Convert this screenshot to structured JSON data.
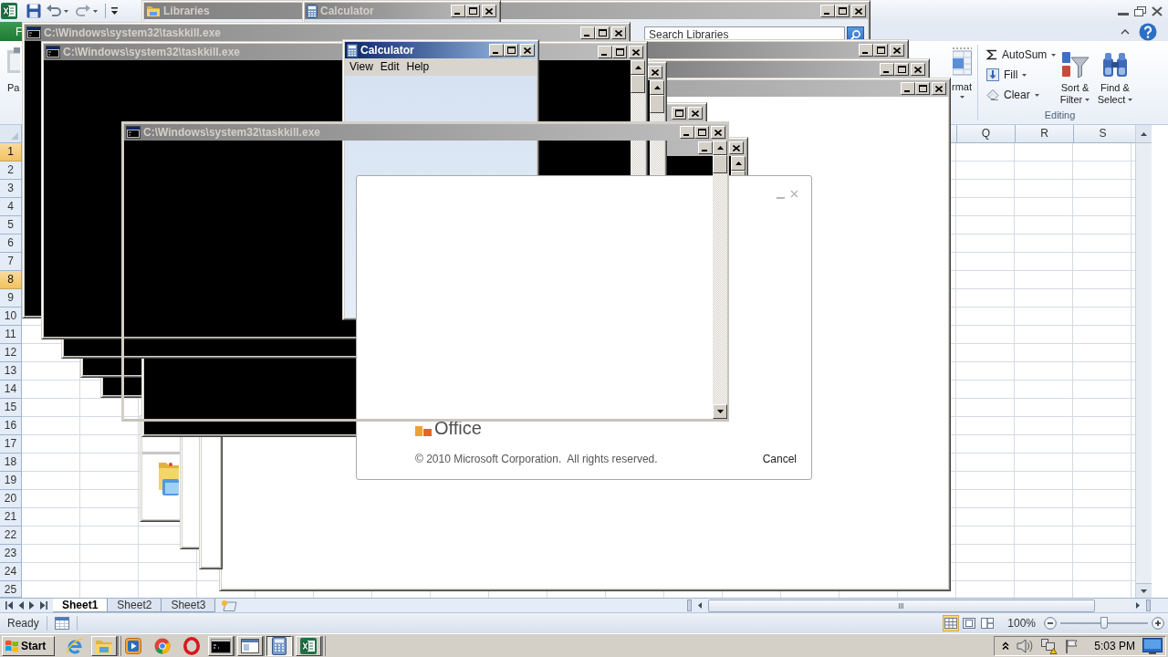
{
  "excel": {
    "file_tab": "F",
    "ribbon": {
      "paste_label": "Pa",
      "format_label": "rmat",
      "editing_items": [
        {
          "kind": "sum",
          "label": "AutoSum"
        },
        {
          "kind": "fill",
          "label": "Fill"
        },
        {
          "kind": "clear",
          "label": "Clear"
        }
      ],
      "editing_buttons": [
        {
          "kind": "sort",
          "label": "Sort & Filter"
        },
        {
          "kind": "find",
          "label": "Find & Select"
        }
      ],
      "group_label": "Editing"
    },
    "columns": [
      "Q",
      "R",
      "S"
    ],
    "rows": [
      {
        "label": "1",
        "selected": true
      },
      {
        "label": "2",
        "selected": false
      },
      {
        "label": "3",
        "selected": false
      },
      {
        "label": "4",
        "selected": false
      },
      {
        "label": "5",
        "selected": false
      },
      {
        "label": "6",
        "selected": false
      },
      {
        "label": "7",
        "selected": false
      },
      {
        "label": "8",
        "selected": true
      },
      {
        "label": "9",
        "selected": false
      },
      {
        "label": "10",
        "selected": false
      },
      {
        "label": "11",
        "selected": false
      },
      {
        "label": "12",
        "selected": false
      },
      {
        "label": "13",
        "selected": false
      },
      {
        "label": "14",
        "selected": false
      },
      {
        "label": "15",
        "selected": false
      },
      {
        "label": "16",
        "selected": false
      },
      {
        "label": "17",
        "selected": false
      },
      {
        "label": "18",
        "selected": false
      },
      {
        "label": "19",
        "selected": false
      },
      {
        "label": "20",
        "selected": false
      },
      {
        "label": "21",
        "selected": false
      },
      {
        "label": "22",
        "selected": false
      },
      {
        "label": "23",
        "selected": false
      },
      {
        "label": "24",
        "selected": false
      },
      {
        "label": "25",
        "selected": false
      }
    ],
    "sheet_tabs": [
      {
        "label": "Sheet1",
        "selected": true
      },
      {
        "label": "Sheet2",
        "selected": false
      },
      {
        "label": "Sheet3",
        "selected": false
      }
    ],
    "status_bar": {
      "text": "Ready",
      "views": [
        {
          "kind": "normal",
          "selected": true
        },
        {
          "kind": "page_layout",
          "selected": false
        },
        {
          "kind": "page_break",
          "selected": false
        }
      ],
      "zoom": "100%",
      "zoom_slider": {
        "level": 0.5
      }
    }
  },
  "windows": [
    {
      "kind": "explorer",
      "title": "Libraries",
      "active": false,
      "search_placeholder": "Search Libraries"
    },
    {
      "kind": "calculator",
      "title": "Calculator",
      "active": false
    },
    {
      "kind": "blank",
      "active": false
    },
    {
      "kind": "blank",
      "active": false
    },
    {
      "kind": "blank",
      "active": false
    },
    {
      "kind": "folder_view"
    },
    {
      "kind": "blank"
    },
    {
      "kind": "blank"
    },
    {
      "kind": "console",
      "active": false
    },
    {
      "kind": "console"
    },
    {
      "kind": "console",
      "active": false
    },
    {
      "kind": "console",
      "active": false
    },
    {
      "kind": "console",
      "title": "C:\\Windows\\system32\\taskkill.exe",
      "active": false
    },
    {
      "kind": "console",
      "title": "C:\\Windows\\system32\\taskkill.exe",
      "active": false
    },
    {
      "kind": "calculator",
      "title": "Calculator",
      "active": true,
      "menu": [
        {
          "label": "View"
        },
        {
          "label": "Edit"
        },
        {
          "label": "Help"
        }
      ]
    },
    {
      "kind": "splash",
      "logo": "Office",
      "copyright": "© 2010 Microsoft Corporation.  All rights reserved.",
      "button": "Cancel"
    },
    {
      "kind": "console_frame",
      "title": "C:\\Windows\\system32\\taskkill.exe",
      "active": false
    }
  ],
  "taskbar": {
    "start": "Start",
    "items": [
      {
        "kind": "e_browser",
        "running": false,
        "selected": false
      },
      {
        "kind": "folder",
        "running": true,
        "selected": false
      },
      {
        "kind": "player",
        "running": false,
        "selected": false
      },
      {
        "kind": "round_browser",
        "running": false,
        "selected": false
      },
      {
        "kind": "o_browser",
        "running": false,
        "selected": false
      },
      {
        "kind": "console",
        "running": true,
        "selected": false
      },
      {
        "kind": "window",
        "running": true,
        "selected": false
      },
      {
        "kind": "calculator",
        "running": true,
        "selected": true
      },
      {
        "kind": "spreadsheet",
        "running": true,
        "selected": false
      }
    ],
    "clock": "5:03 PM"
  }
}
